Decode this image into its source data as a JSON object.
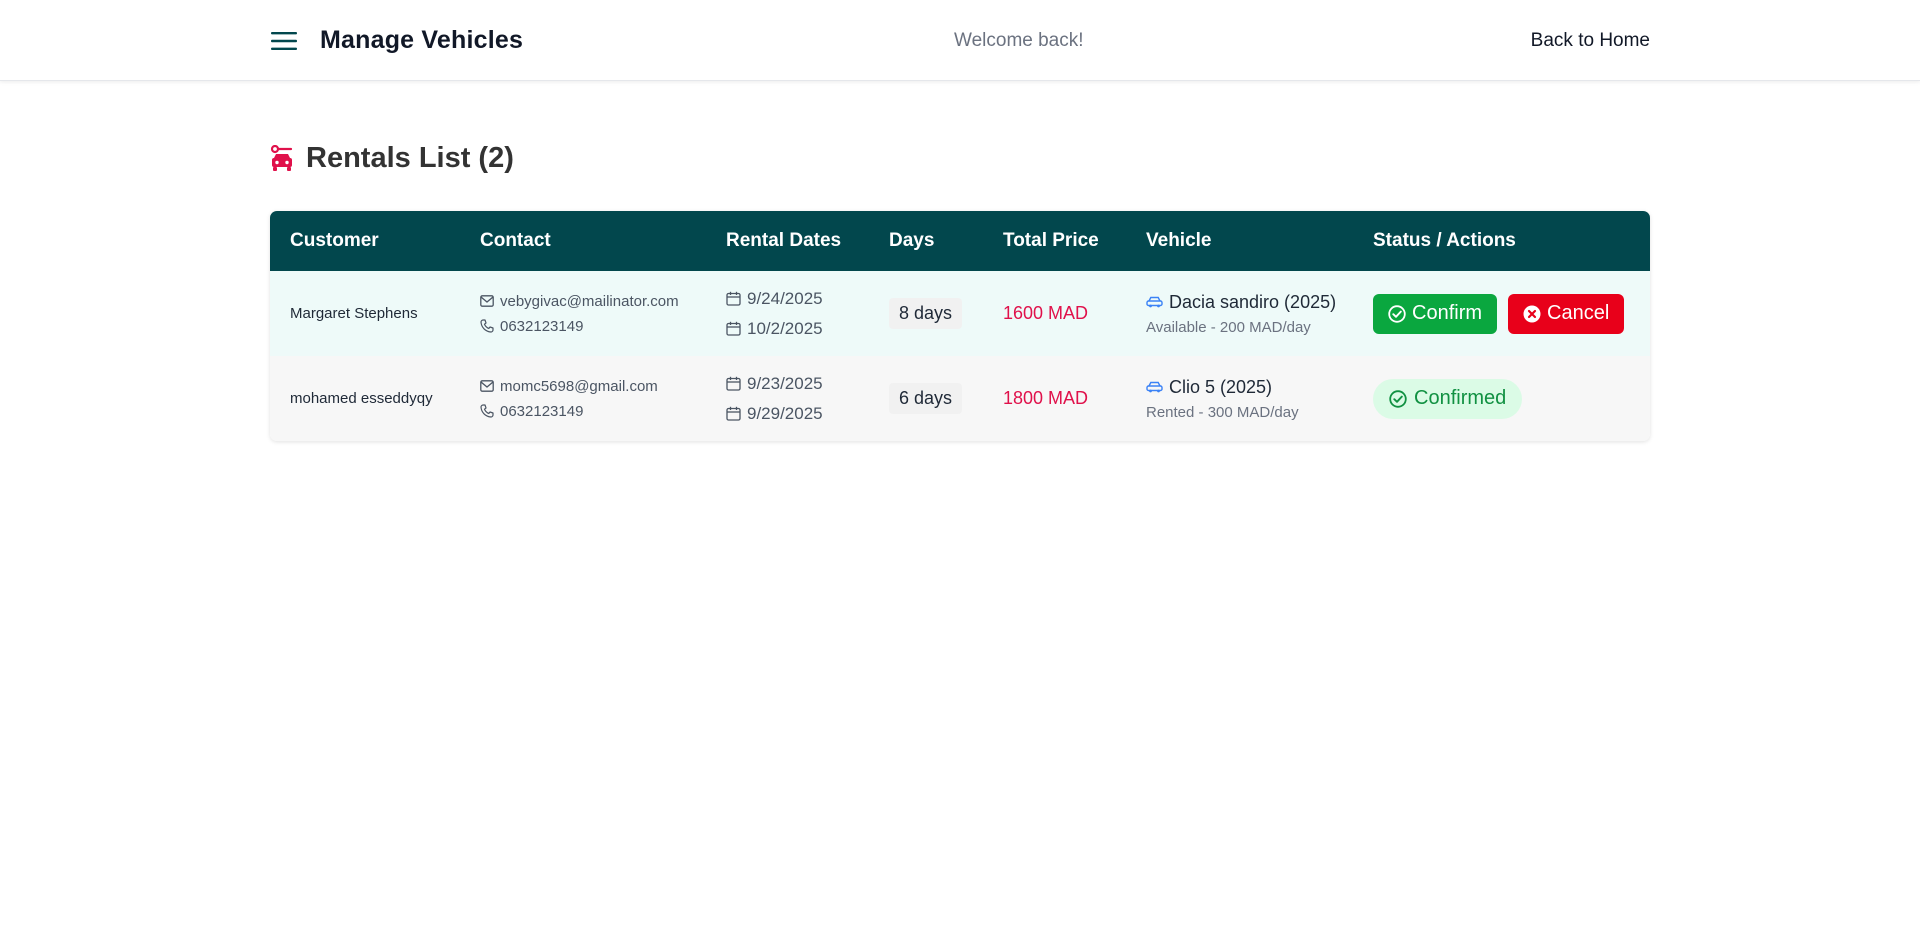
{
  "header": {
    "title": "Manage Vehicles",
    "welcome": "Welcome back!",
    "back_link": "Back to Home"
  },
  "section": {
    "title": "Rentals List (2)"
  },
  "table": {
    "columns": [
      "Customer",
      "Contact",
      "Rental Dates",
      "Days",
      "Total Price",
      "Vehicle",
      "Status / Actions"
    ],
    "rows": [
      {
        "customer": "Margaret Stephens",
        "email": "vebygivac@mailinator.com",
        "phone": "0632123149",
        "start_date": "9/24/2025",
        "end_date": "10/2/2025",
        "days": "8 days",
        "total_price": "1600 MAD",
        "vehicle": "Dacia sandiro (2025)",
        "vehicle_meta": "Available - 200 MAD/day",
        "confirm_label": "Confirm",
        "cancel_label": "Cancel"
      },
      {
        "customer": "mohamed esseddyqy",
        "email": "momc5698@gmail.com",
        "phone": "0632123149",
        "start_date": "9/23/2025",
        "end_date": "9/29/2025",
        "days": "6 days",
        "total_price": "1800 MAD",
        "vehicle": "Clio 5 (2025)",
        "vehicle_meta": "Rented - 300 MAD/day",
        "status": "Confirmed"
      }
    ]
  },
  "icons": {
    "menu": "menu-icon",
    "section": "car-rental-icon",
    "email": "mail-icon",
    "phone": "phone-icon",
    "date": "calendar-icon",
    "vehicle": "car-icon",
    "confirm": "check-circle-icon",
    "cancel": "x-circle-icon"
  },
  "colors": {
    "header_bg": "#02474d",
    "accent_pink": "#e0114b",
    "confirm_green": "#0aa73f",
    "cancel_red": "#e8001a",
    "status_bg": "#dbfbe6",
    "status_text": "#119142",
    "vehicle_icon": "#3b82f6"
  }
}
